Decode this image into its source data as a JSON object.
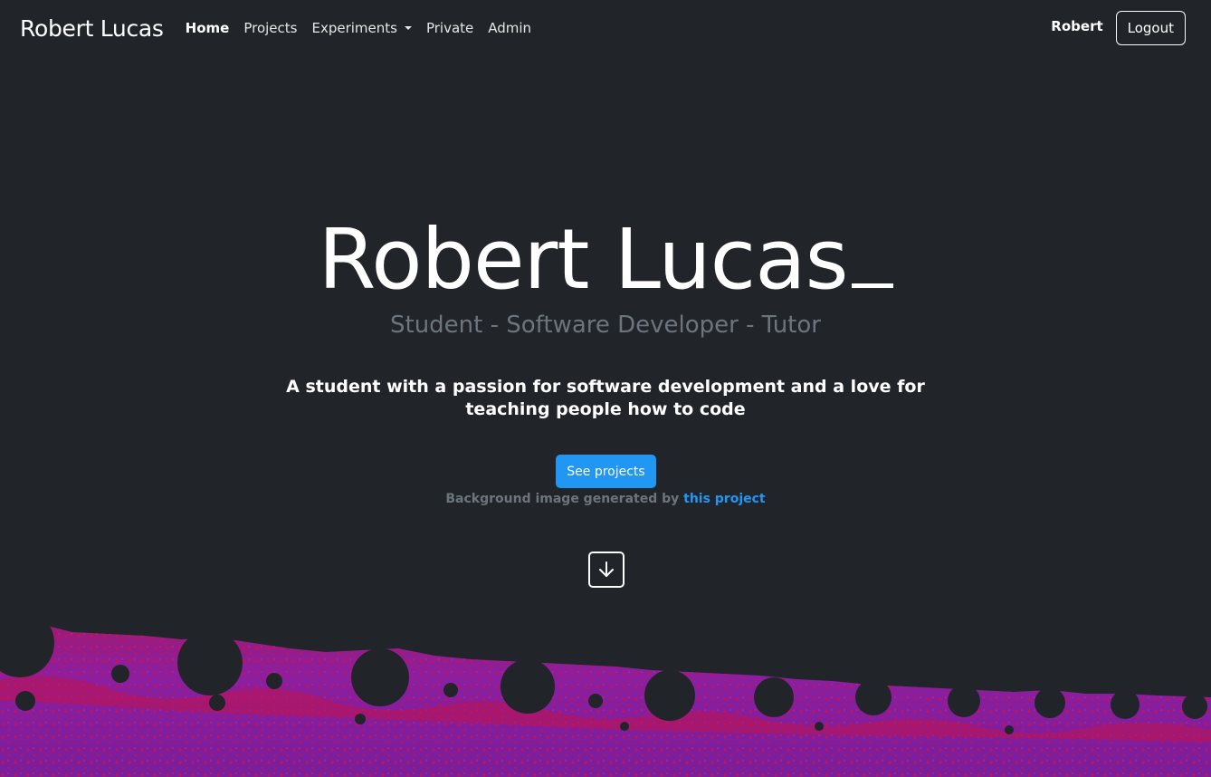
{
  "navbar": {
    "brand": "Robert Lucas",
    "links": [
      {
        "label": "Home",
        "active": true
      },
      {
        "label": "Projects",
        "active": false
      },
      {
        "label": "Experiments",
        "active": false,
        "dropdown": true
      },
      {
        "label": "Private",
        "active": false
      },
      {
        "label": "Admin",
        "active": false
      }
    ],
    "user": "Robert",
    "logout_label": "Logout"
  },
  "hero": {
    "title": "Robert Lucas",
    "subtitle": "Student - Software Developer - Tutor",
    "description": "A student with a passion for software development and a love for teaching people how to code",
    "cta_label": "See projects",
    "credit_text": "Background image generated by ",
    "credit_link": "this project",
    "scroll_icon": "arrow-down-icon"
  },
  "colors": {
    "background": "#212529",
    "accent": "#2196f3",
    "muted": "#6c757d",
    "fractal_purple": "#8b1fa0",
    "fractal_red": "#c8124a"
  }
}
